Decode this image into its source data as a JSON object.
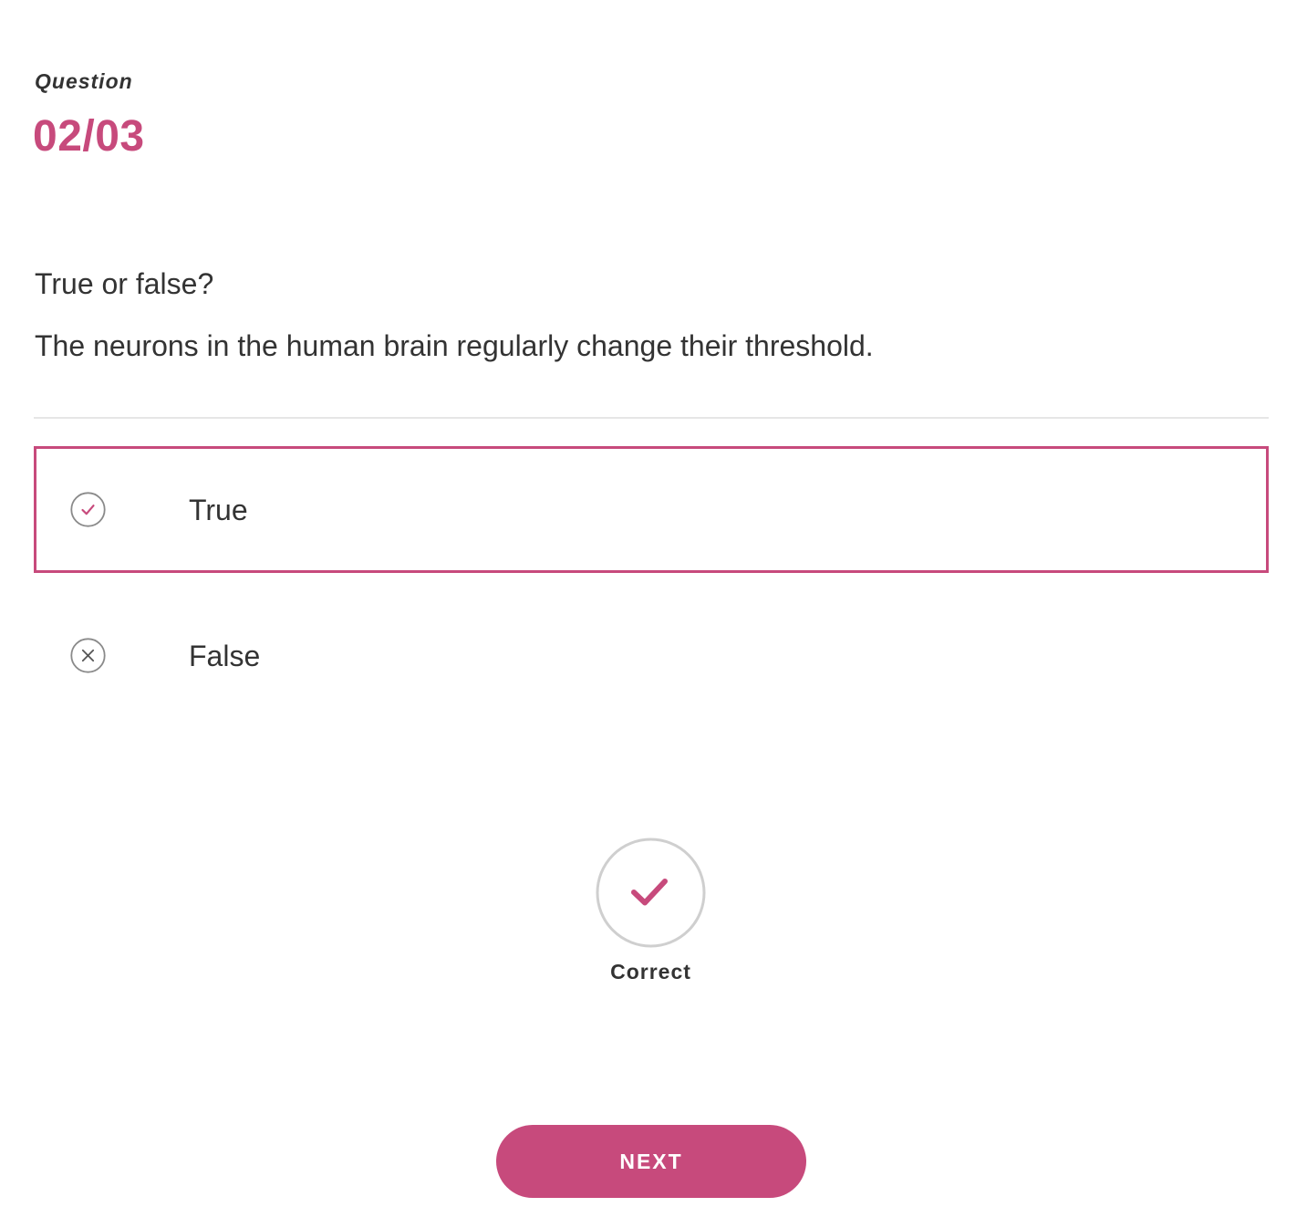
{
  "question": {
    "label": "Question",
    "counter": "02/03"
  },
  "prompt": {
    "line1": "True or false?",
    "line2": "The neurons in the human brain regularly change their threshold."
  },
  "options": [
    {
      "label": "True",
      "icon": "check-circle-icon",
      "selected": true
    },
    {
      "label": "False",
      "icon": "x-circle-icon",
      "selected": false
    }
  ],
  "result": {
    "icon": "check-circle-icon",
    "label": "Correct"
  },
  "next_button": {
    "label": "NEXT"
  },
  "colors": {
    "accent": "#c74a7c",
    "text": "#333333",
    "divider": "#e6e6e6",
    "icon_ring": "#8a8a8a",
    "result_ring": "#cfcfcf"
  }
}
